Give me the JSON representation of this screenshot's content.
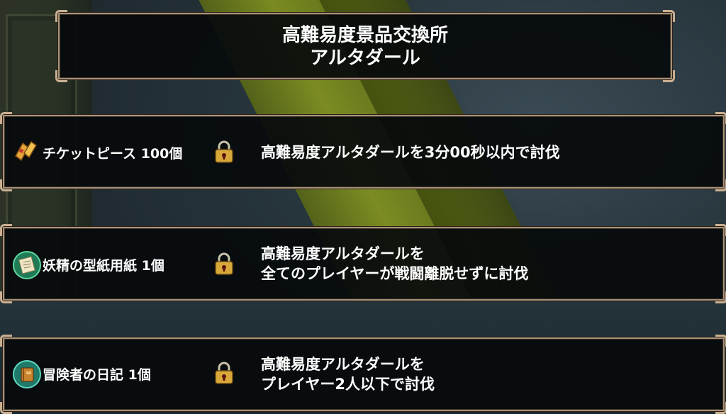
{
  "header": {
    "title_line1": "高難易度景品交換所",
    "title_line2": "アルタダール"
  },
  "rewards": [
    {
      "icon": "ticket-piece-icon",
      "item": "チケットピース 100個",
      "locked": true,
      "condition_line1": "高難易度アルタダールを3分00秒以内で討伐",
      "condition_line2": ""
    },
    {
      "icon": "fairy-pattern-paper-icon",
      "item": "妖精の型紙用紙 1個",
      "locked": true,
      "condition_line1": "高難易度アルタダールを",
      "condition_line2": "全てのプレイヤーが戦闘離脱せずに討伐"
    },
    {
      "icon": "adventurer-diary-icon",
      "item": "冒険者の日記 1個",
      "locked": true,
      "condition_line1": "高難易度アルタダールを",
      "condition_line2": "プレイヤー2人以下で討伐"
    }
  ],
  "colors": {
    "panel_bg": "#06090c",
    "frame": "#a8927a",
    "lock_gold": "#d8a93a",
    "pillar": "#8a9a1c"
  }
}
